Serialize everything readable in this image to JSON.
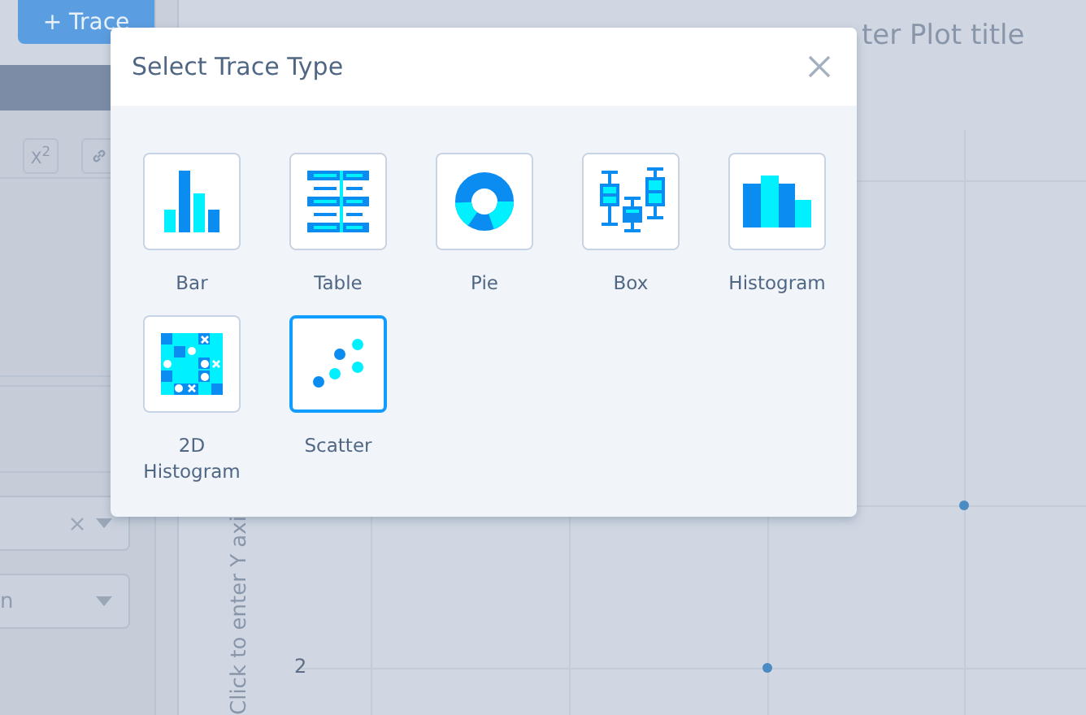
{
  "sidebar": {
    "add_trace_button": "+ Trace",
    "format_buttons": [
      {
        "kind": "superscript",
        "label": "X$^{2}$"
      },
      {
        "kind": "link"
      }
    ],
    "dropdowns": [
      {
        "kind": "clearable"
      },
      {
        "kind": "value",
        "value": "n"
      }
    ]
  },
  "plot": {
    "title": "ter Plot title",
    "y_axis_label": "Click to enter Y axi",
    "tick_label": "2"
  },
  "modal": {
    "title": "Select Trace Type",
    "trace_types": [
      {
        "label": "Bar",
        "kind": "bar",
        "selected": false
      },
      {
        "label": "Table",
        "kind": "table",
        "selected": false
      },
      {
        "label": "Pie",
        "kind": "pie",
        "selected": false
      },
      {
        "label": "Box",
        "kind": "box",
        "selected": false
      },
      {
        "label": "Histogram",
        "kind": "histogram",
        "selected": false
      },
      {
        "label": "2D Histogram",
        "kind": "histogram2d",
        "selected": false
      },
      {
        "label": "Scatter",
        "kind": "scatter",
        "selected": true
      }
    ]
  }
}
